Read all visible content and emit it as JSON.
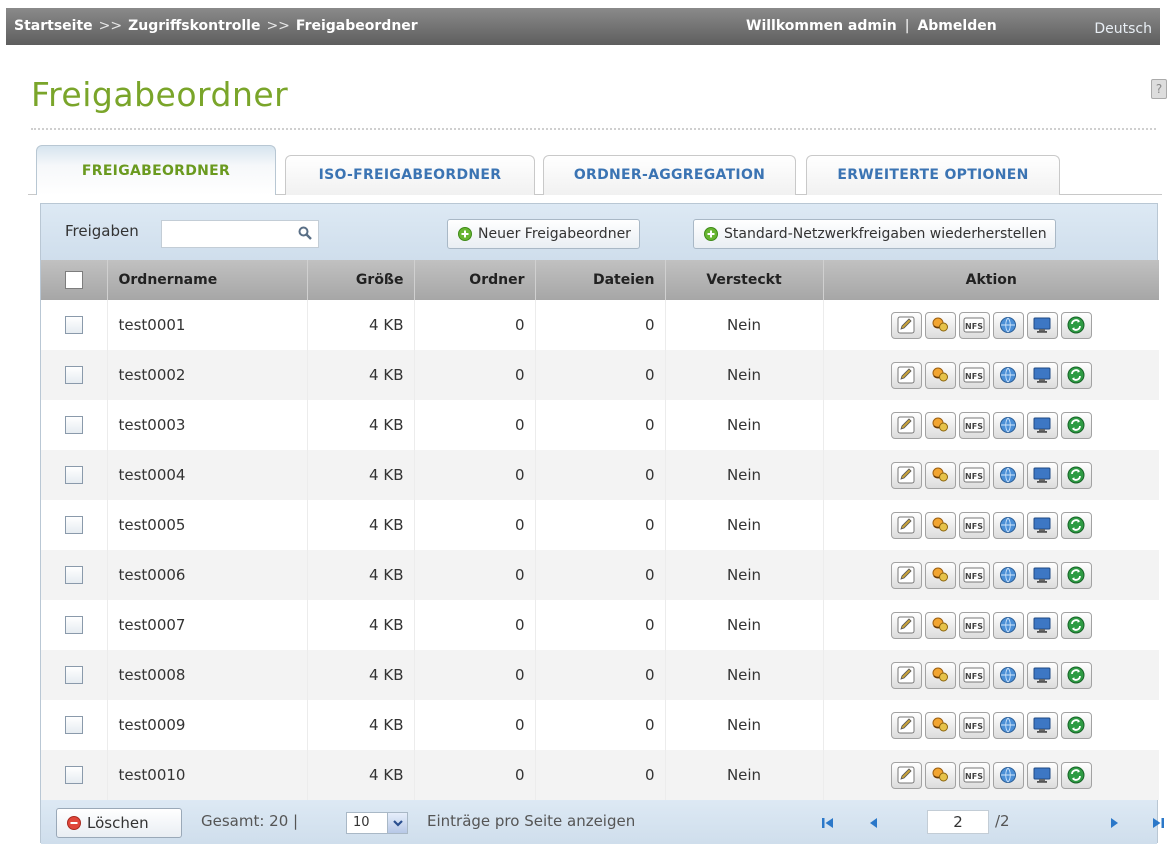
{
  "header": {
    "breadcrumb": [
      "Startseite",
      "Zugriffskontrolle",
      "Freigabeordner"
    ],
    "breadcrumb_separator": ">>",
    "welcome": "Willkommen admin",
    "divider": "|",
    "logout": "Abmelden",
    "language": "Deutsch"
  },
  "page": {
    "title": "Freigabeordner",
    "help": "?"
  },
  "tabs": [
    {
      "label": "FREIGABEORDNER",
      "active": true
    },
    {
      "label": "ISO-FREIGABEORDNER",
      "active": false
    },
    {
      "label": "ORDNER-AGGREGATION",
      "active": false
    },
    {
      "label": "ERWEITERTE OPTIONEN",
      "active": false
    }
  ],
  "toolbar": {
    "search_label": "Freigaben",
    "search_value": "",
    "new_button": "Neuer Freigabeordner",
    "restore_button": "Standard-Netzwerkfreigaben wiederherstellen"
  },
  "table": {
    "columns": [
      "Ordnername",
      "Größe",
      "Ordner",
      "Dateien",
      "Versteckt",
      "Aktion"
    ],
    "rows": [
      {
        "name": "test0001",
        "size": "4 KB",
        "folders": "0",
        "files": "0",
        "hidden": "Nein"
      },
      {
        "name": "test0002",
        "size": "4 KB",
        "folders": "0",
        "files": "0",
        "hidden": "Nein"
      },
      {
        "name": "test0003",
        "size": "4 KB",
        "folders": "0",
        "files": "0",
        "hidden": "Nein"
      },
      {
        "name": "test0004",
        "size": "4 KB",
        "folders": "0",
        "files": "0",
        "hidden": "Nein"
      },
      {
        "name": "test0005",
        "size": "4 KB",
        "folders": "0",
        "files": "0",
        "hidden": "Nein"
      },
      {
        "name": "test0006",
        "size": "4 KB",
        "folders": "0",
        "files": "0",
        "hidden": "Nein"
      },
      {
        "name": "test0007",
        "size": "4 KB",
        "folders": "0",
        "files": "0",
        "hidden": "Nein"
      },
      {
        "name": "test0008",
        "size": "4 KB",
        "folders": "0",
        "files": "0",
        "hidden": "Nein"
      },
      {
        "name": "test0009",
        "size": "4 KB",
        "folders": "0",
        "files": "0",
        "hidden": "Nein"
      },
      {
        "name": "test0010",
        "size": "4 KB",
        "folders": "0",
        "files": "0",
        "hidden": "Nein"
      }
    ],
    "action_icons": [
      "edit-icon",
      "permissions-icon",
      "nfs-icon",
      "network-icon",
      "monitor-icon",
      "refresh-icon"
    ],
    "nfs_label": "NFS"
  },
  "footer": {
    "delete_button": "Löschen",
    "total": "Gesamt: 20  |",
    "per_page_value": "10",
    "per_page_label": "Einträge pro Seite anzeigen",
    "current_page": "2",
    "total_pages": "/2"
  },
  "colors": {
    "title_green": "#7aa52a",
    "tab_blue": "#3b74b3",
    "toolbar_bg": "#d7e4f0",
    "header_gray": "#b3b3b3"
  }
}
